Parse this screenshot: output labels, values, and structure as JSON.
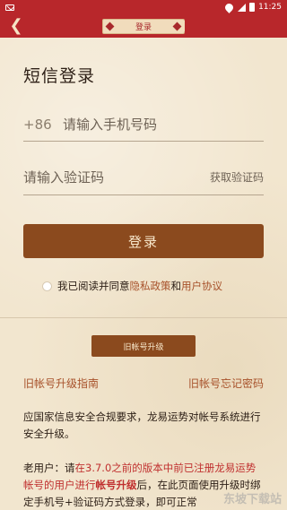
{
  "status_bar": {
    "time": "11:25"
  },
  "header": {
    "title": "登录"
  },
  "login": {
    "title": "短信登录",
    "country_code": "+86",
    "phone_placeholder": "请输入手机号码",
    "code_placeholder": "请输入验证码",
    "get_code": "获取验证码",
    "submit": "登录"
  },
  "agreement": {
    "prefix": "我已阅读并同意",
    "privacy": "隐私政策",
    "and": "和",
    "terms": "用户协议"
  },
  "upgrade": {
    "button": "旧帐号升级",
    "guide": "旧帐号升级指南",
    "forgot": "旧帐号忘记密码",
    "paragraph1": "应国家信息安全合规要求，龙易运势对帐号系统进行安全升级。",
    "p2_lead": "老用户：请",
    "p2_red1": "在3.7.0之前的版本中前已注册龙易运势帐号的用户进行",
    "p2_bold": "帐号升级",
    "p2_rest": "后，在此页面使用升级时绑定手机号+验证码方式登录，即可正常"
  },
  "watermark": "东坡下载站"
}
